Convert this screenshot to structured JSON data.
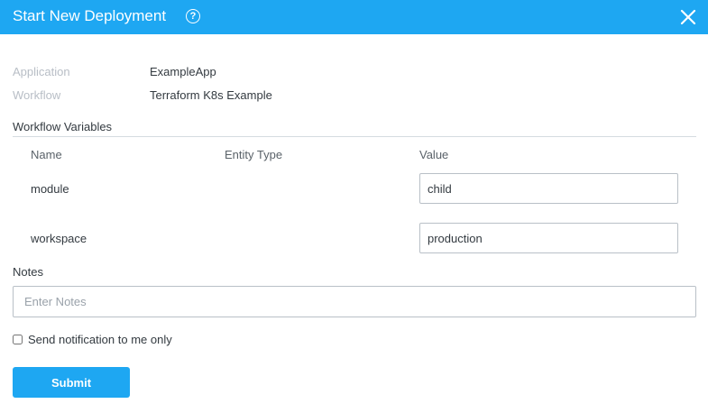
{
  "header": {
    "title": "Start New Deployment",
    "help_icon_glyph": "?",
    "help_icon": "question-circle-icon",
    "close_icon": "close-icon",
    "background_color": "#1ea7f2"
  },
  "meta": {
    "application_label": "Application",
    "application_value": "ExampleApp",
    "workflow_label": "Workflow",
    "workflow_value": "Terraform K8s Example"
  },
  "workflow_variables": {
    "title": "Workflow Variables",
    "columns": [
      "Name",
      "Entity Type",
      "Value"
    ],
    "rows": [
      {
        "name": "module",
        "entity_type": "",
        "value": "child"
      },
      {
        "name": "workspace",
        "entity_type": "",
        "value": "production"
      }
    ]
  },
  "notes": {
    "label": "Notes",
    "placeholder": "Enter Notes",
    "value": ""
  },
  "notification": {
    "label": "Send notification to me only",
    "checked": false
  },
  "submit": {
    "label": "Submit",
    "color": "#1ea7f2"
  }
}
